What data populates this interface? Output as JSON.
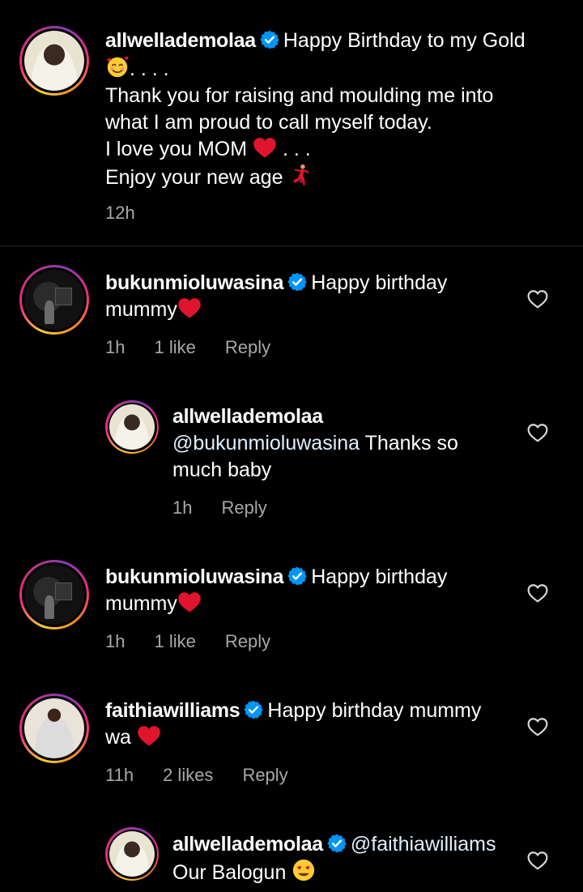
{
  "caption": {
    "username": "allwellademolaa",
    "text_line1": "Happy Birthday to my Gold",
    "text_line2": ". . . .",
    "text_line3": "Thank you for raising and moulding me into",
    "text_line4": "what I am proud to call myself today.",
    "text_line5": "I love you MOM",
    "text_line5_tail": ". . .",
    "text_line6": "Enjoy your new age",
    "time": "12h"
  },
  "comments": [
    {
      "username": "bukunmioluwasina",
      "text": "Happy birthday",
      "text_line2": "mummy",
      "time": "1h",
      "likes": "1 like",
      "reply": "Reply"
    },
    {
      "username": "allwellademolaa",
      "mention": "@bukunmioluwasina",
      "text": "Thanks so",
      "text_line2": "much baby",
      "time": "1h",
      "reply": "Reply"
    },
    {
      "username": "bukunmioluwasina",
      "text": "Happy birthday",
      "text_line2": "mummy",
      "time": "1h",
      "likes": "1 like",
      "reply": "Reply"
    },
    {
      "username": "faithiawilliams",
      "text": "Happy birthday mummy",
      "text_line2": "wa",
      "time": "11h",
      "likes": "2 likes",
      "reply": "Reply"
    },
    {
      "username": "allwellademolaa",
      "mention": "@faithiawilliams",
      "text_line2": "Our Balogun",
      "time": "",
      "reply": ""
    }
  ],
  "icons": {
    "verified": "verified-badge-icon",
    "like": "heart-outline-icon",
    "heart_emoji": "red-heart-emoji",
    "smiling_hearts_emoji": "smiling-face-with-hearts-emoji",
    "dancer_emoji": "woman-dancing-emoji",
    "heart_eyes_emoji": "heart-eyes-emoji"
  },
  "colors": {
    "background": "#000000",
    "meta_text": "#a8a8a8",
    "verified": "#0095f6",
    "heart": "#e0142d",
    "mention": "#e0f1ff"
  }
}
